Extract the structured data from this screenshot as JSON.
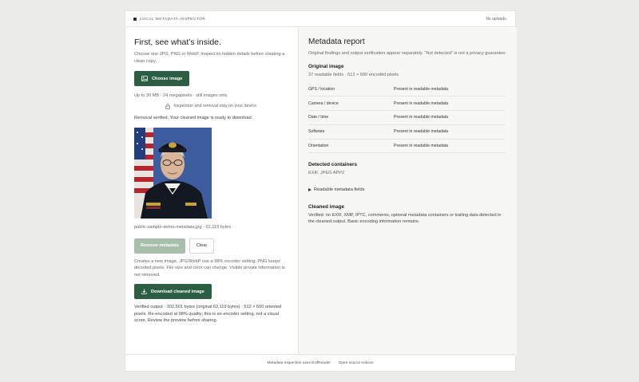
{
  "app": {
    "title": "LOCAL METADATA INSPECTOR",
    "uploads_status": "No uploads."
  },
  "left": {
    "heading": "First, see what’s inside.",
    "intro": "Choose one JPG, PNG or WebP. Inspect its hidden details before creating a clean copy.",
    "choose_label": "Choose image",
    "limits": "Up to 30 MB · 24 megapixels · still images only",
    "privacy_note": "Inspection and removal stay on your device.",
    "removal_status": "Removal verified. Your cleaned image is ready to download.",
    "file_caption": "public-sample-demo-metadata.jpg · 62,119 bytes",
    "remove_label": "Remove metadata",
    "clear_label": "Clear",
    "encoder_note": "Creates a new image. JPG/WebP use a 98% encoder setting; PNG keeps decoded pixels. File size and color can change. Visible private information is not removed.",
    "download_label": "Download cleaned image",
    "verified_output": "Verified output · 102,501 bytes (original 62,119 bytes) · 512 × 600 oriented pixels. Re-encoded at 98% quality; this is an encoder setting, not a visual score. Review the preview before sharing."
  },
  "report": {
    "title": "Metadata report",
    "subtitle": "Original findings and output verification appear separately. “Not detected” is not a privacy guarantee.",
    "original_heading": "Original image",
    "original_summary": "37 readable fields · 512 × 600 encoded pixels",
    "fields": [
      {
        "name": "GPS / location",
        "status": "Present in readable metadata"
      },
      {
        "name": "Camera / device",
        "status": "Present in readable metadata"
      },
      {
        "name": "Date / time",
        "status": "Present in readable metadata"
      },
      {
        "name": "Software",
        "status": "Present in readable metadata"
      },
      {
        "name": "Orientation",
        "status": "Present in readable metadata"
      }
    ],
    "containers_heading": "Detected containers",
    "containers_value": "EXIF, JPEG APP2",
    "readable_toggle": "Readable metadata fields",
    "cleaned_heading": "Cleaned image",
    "cleaned_text": "Verified: no EXIF, XMP, IPTC, comments, optional metadata containers or trailing data detected in the cleaned output. Basic encoding information remains."
  },
  "footer": {
    "credit": "Metadata inspection uses ExifReader",
    "separator": "·",
    "notices_link": "Open source notices"
  },
  "colors": {
    "accent": "#2b5e42",
    "accent_disabled": "#a8bfae",
    "report_bg": "#f7f7f6"
  },
  "icons": {
    "choose": "image-icon",
    "lock": "lock-icon",
    "download": "download-icon",
    "disclosure": "triangle-right-icon"
  }
}
